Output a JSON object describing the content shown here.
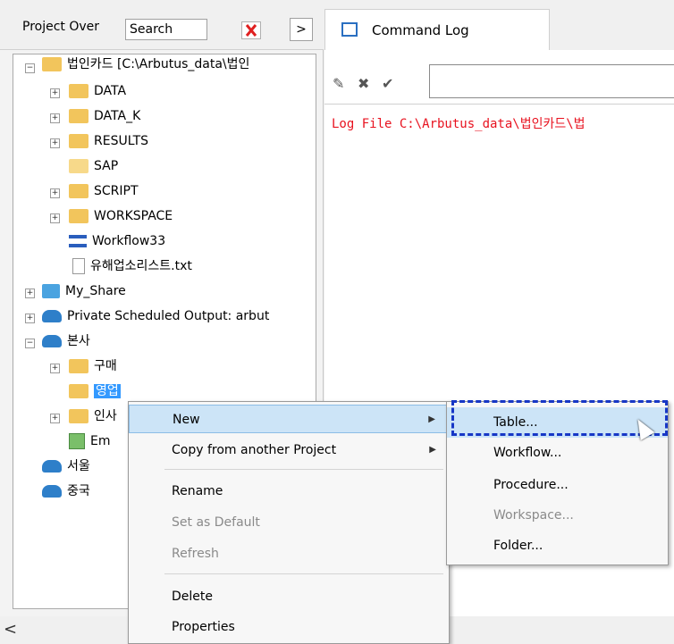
{
  "left_panel": {
    "title": "Project Over",
    "search_value": "Search",
    "expand_arrow": ">",
    "scroll_left": "<"
  },
  "tree": [
    {
      "label": "법인카드 [C:\\Arbutus_data\\법인",
      "icon": "folder-icon",
      "expanded": true
    },
    {
      "label": "DATA",
      "icon": "folder-icon"
    },
    {
      "label": "DATA_K",
      "icon": "folder-icon"
    },
    {
      "label": "RESULTS",
      "icon": "folder-icon"
    },
    {
      "label": "SAP",
      "icon": "open-folder-icon"
    },
    {
      "label": "SCRIPT",
      "icon": "folder-icon"
    },
    {
      "label": "WORKSPACE",
      "icon": "folder-icon"
    },
    {
      "label": "Workflow33",
      "icon": "workflow-icon"
    },
    {
      "label": "유해업소리스트.txt",
      "icon": "document-icon"
    },
    {
      "label": "My_Share",
      "icon": "user-folder-icon"
    },
    {
      "label": "Private Scheduled Output:  arbut",
      "icon": "cloud-folder-icon"
    },
    {
      "label": "본사",
      "icon": "cloud-folder-icon",
      "expanded": true
    },
    {
      "label": "구매",
      "icon": "folder-icon"
    },
    {
      "label": "영업",
      "icon": "folder-icon",
      "selected": true
    },
    {
      "label": "인사",
      "icon": "folder-icon"
    },
    {
      "label": "Em",
      "icon": "email-icon"
    },
    {
      "label": "서울",
      "icon": "cloud-folder-icon"
    },
    {
      "label": "중국",
      "icon": "cloud-folder-icon"
    }
  ],
  "command_log": {
    "tab_label": "Command Log",
    "log_line": "Log File C:\\Arbutus_data\\법인카드\\법",
    "toolbar": {
      "edit": "✎",
      "clear": "✖",
      "apply": "✔"
    }
  },
  "context_menu": {
    "items": [
      {
        "label": "New",
        "submenu": true,
        "highlighted": true
      },
      {
        "label": "Copy from another Project",
        "submenu": true
      },
      {
        "label": "Rename"
      },
      {
        "label": "Set as Default",
        "disabled": true
      },
      {
        "label": "Refresh",
        "disabled": true
      },
      {
        "label": "Delete"
      },
      {
        "label": "Properties"
      }
    ]
  },
  "submenu": {
    "items": [
      {
        "label": "Table...",
        "highlighted": true
      },
      {
        "label": "Workflow..."
      },
      {
        "label": "Procedure..."
      },
      {
        "label": "Workspace...",
        "disabled": true
      },
      {
        "label": "Folder..."
      }
    ]
  },
  "colors": {
    "accent": "#3399ff",
    "log_text": "#e8121f",
    "highlight_box": "#1737c6"
  }
}
